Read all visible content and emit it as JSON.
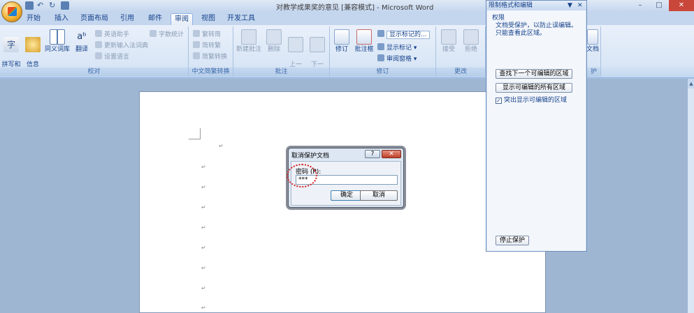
{
  "window": {
    "title": "对教学成果奖的意见 [兼容模式] - Microsoft Word",
    "minimize": "–",
    "maximize": "□",
    "close": "✕"
  },
  "tabs": [
    {
      "label": "开始"
    },
    {
      "label": "插入"
    },
    {
      "label": "页面布局"
    },
    {
      "label": "引用"
    },
    {
      "label": "邮件"
    },
    {
      "label": "审阅",
      "active": true
    },
    {
      "label": "视图"
    },
    {
      "label": "开发工具"
    }
  ],
  "ribbon": {
    "proofing": {
      "label": "校对",
      "spell": "拼写和\n语法",
      "research": "信息\n检索",
      "thesaurus": "同义词库",
      "translate": "翻译",
      "english_assist": "英语助手",
      "update_ime": "更新输入法词典",
      "set_language": "设置语言",
      "word_count": "字数统计"
    },
    "chinese": {
      "label": "中文简繁转换",
      "to_trad": "繁转简",
      "to_simp": "简转繁",
      "convert": "简繁转换"
    },
    "comments": {
      "label": "批注",
      "new": "新建批注",
      "delete": "删除",
      "prev": "上一\n条",
      "next": "下一\n条"
    },
    "tracking": {
      "label": "修订",
      "track": "修订",
      "balloons": "批注框",
      "display_dropdown": "显示标记的...",
      "show_markup": "显示标记",
      "review_pane": "审阅窗格"
    },
    "changes": {
      "label": "更改",
      "accept": "接受",
      "reject": "拒绝"
    },
    "protect": {
      "label": "护",
      "doc": "文档"
    }
  },
  "task_pane": {
    "title": "限制格式和编辑",
    "section": "权限",
    "description": "文档受保护，以防止误编辑。只能查看此区域。",
    "find_next": "查找下一个可编辑的区域",
    "show_all": "显示可编辑的所有区域",
    "highlight_label": "突出显示可编辑的区域",
    "highlight_checked": "✓",
    "stop_protection": "停止保护",
    "pin": "▼",
    "close": "✕"
  },
  "dialog": {
    "title": "取消保护文档",
    "help": "?",
    "close": "✕",
    "password_label": "密码 (P):",
    "password_value": "***",
    "ok": "确定",
    "cancel": "取消"
  },
  "document": {
    "para_mark": "↵"
  }
}
